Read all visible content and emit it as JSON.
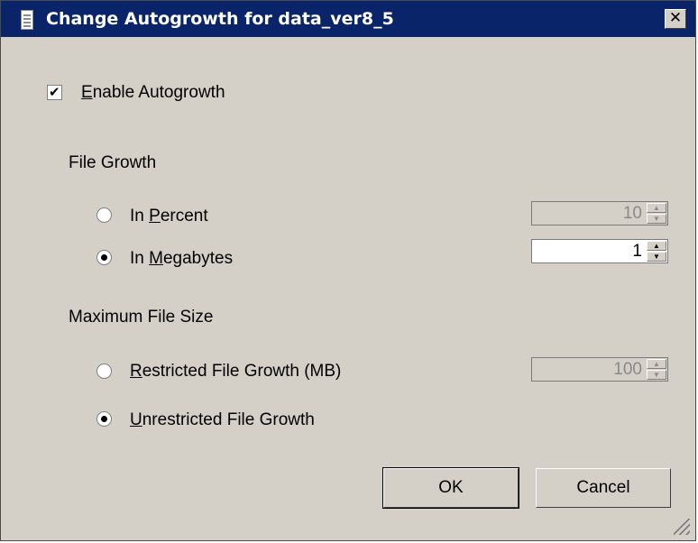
{
  "window": {
    "title": "Change Autogrowth for data_ver8_5",
    "close_glyph": "✕"
  },
  "enable_autogrowth": {
    "checked": true,
    "mnemonic": "E",
    "rest": "nable Autogrowth"
  },
  "file_growth": {
    "heading": "File Growth",
    "in_percent": {
      "prefix": "In ",
      "mnemonic": "P",
      "rest": "ercent",
      "selected": false,
      "value": "10",
      "enabled": false
    },
    "in_megabytes": {
      "prefix": "In ",
      "mnemonic": "M",
      "rest": "egabytes",
      "selected": true,
      "value": "1",
      "enabled": true
    }
  },
  "max_file_size": {
    "heading": "Maximum File Size",
    "restricted": {
      "mnemonic": "R",
      "rest": "estricted File Growth (MB)",
      "selected": false,
      "value": "100",
      "enabled": false
    },
    "unrestricted": {
      "mnemonic": "U",
      "rest": "nrestricted File Growth",
      "selected": true
    }
  },
  "buttons": {
    "ok": "OK",
    "cancel": "Cancel"
  }
}
